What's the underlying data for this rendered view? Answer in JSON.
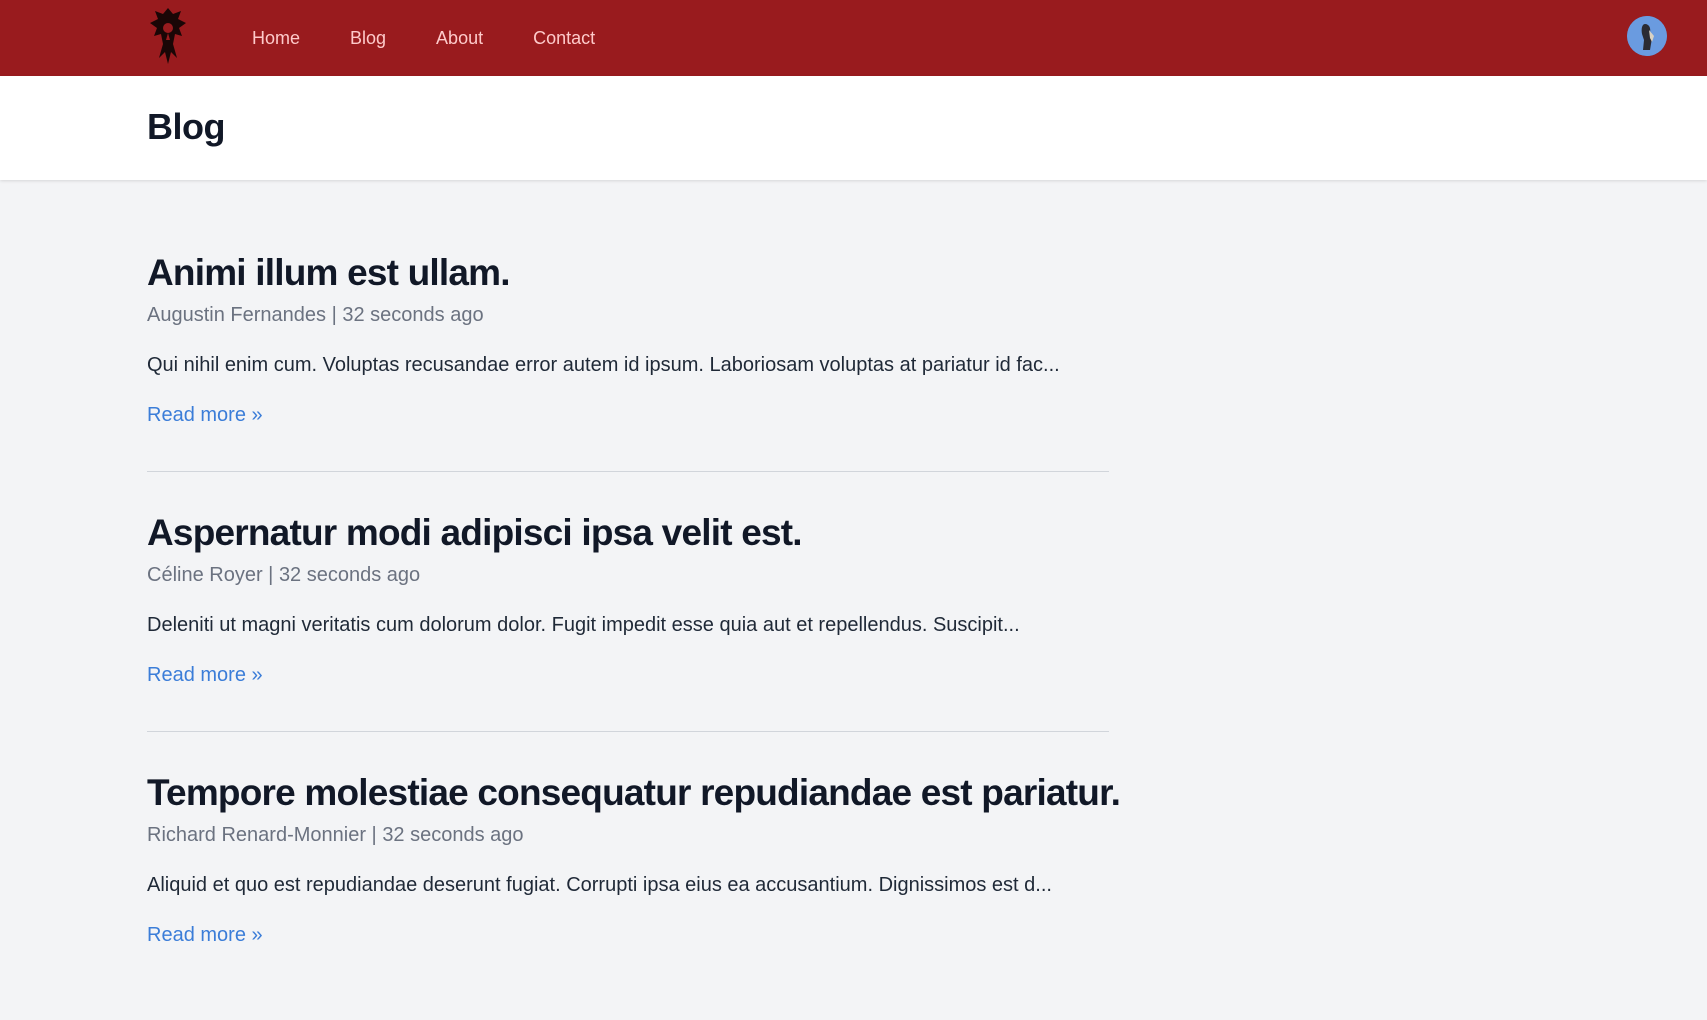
{
  "nav": {
    "logo_icon": "horde-emblem-icon",
    "links": [
      {
        "label": "Home"
      },
      {
        "label": "Blog"
      },
      {
        "label": "About"
      },
      {
        "label": "Contact"
      }
    ],
    "avatar_icon": "user-avatar-icon"
  },
  "header": {
    "title": "Blog"
  },
  "posts": [
    {
      "title": "Animi illum est ullam.",
      "author": "Augustin Fernandes",
      "time": "32 seconds ago",
      "excerpt": "Qui nihil enim cum. Voluptas recusandae error autem id ipsum. Laboriosam voluptas at pariatur id fac...",
      "read_more": "Read more »"
    },
    {
      "title": "Aspernatur modi adipisci ipsa velit est.",
      "author": "Céline Royer",
      "time": "32 seconds ago",
      "excerpt": "Deleniti ut magni veritatis cum dolorum dolor. Fugit impedit esse quia aut et repellendus. Suscipit...",
      "read_more": "Read more »"
    },
    {
      "title": "Tempore molestiae consequatur repudiandae est pariatur.",
      "author": "Richard Renard-Monnier",
      "time": "32 seconds ago",
      "excerpt": "Aliquid et quo est repudiandae deserunt fugiat. Corrupti ipsa eius ea accusantium. Dignissimos est d...",
      "read_more": "Read more »"
    }
  ],
  "colors": {
    "nav_bg": "#991b1e",
    "nav_link": "#fecaca",
    "page_bg": "#f3f4f6",
    "link": "#3b7dd8"
  }
}
